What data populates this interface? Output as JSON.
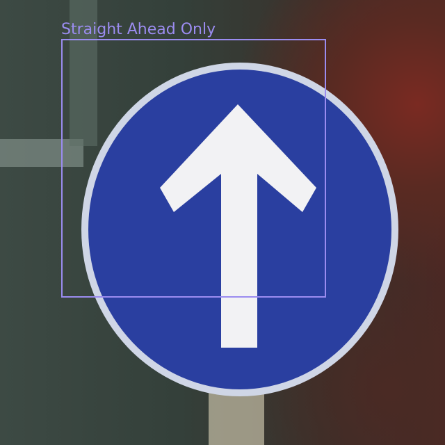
{
  "annotation": {
    "label": "Straight Ahead Only",
    "color": "#9b8cf0"
  },
  "scene": {
    "sign_color": "#2a3fa0",
    "arrow_color": "#f2f2f4",
    "rim_color": "#cfd6e6"
  }
}
